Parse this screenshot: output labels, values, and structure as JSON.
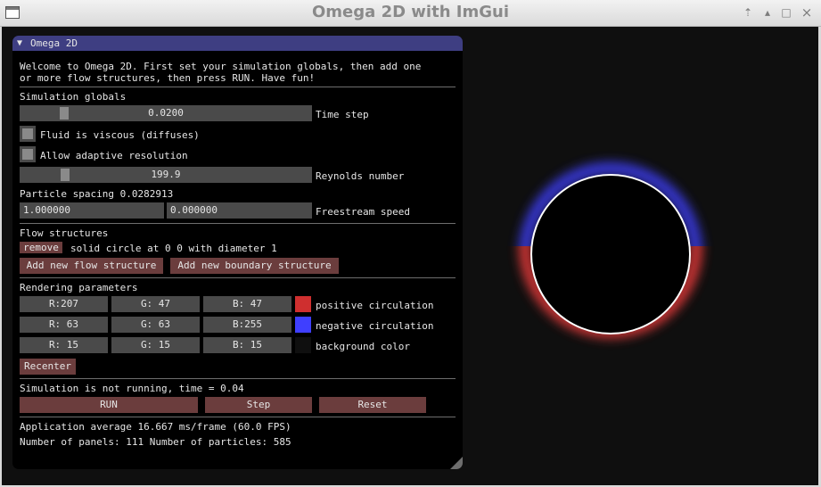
{
  "window": {
    "title": "Omega 2D with ImGui",
    "controls": {
      "pin": "⇡",
      "shade": "▴",
      "maximize": "□",
      "close": "×"
    }
  },
  "panel": {
    "title": "Omega 2D",
    "collapse_arrow": "▼",
    "welcome_line1": "Welcome to Omega 2D. First set your simulation globals, then add one",
    "welcome_line2": "or more flow structures, then press RUN. Have fun!"
  },
  "globals": {
    "heading": "Simulation globals",
    "time_step_value": "0.0200",
    "time_step_label": "Time step",
    "viscous_label": "Fluid is viscous (diffuses)",
    "adaptive_label": "Allow adaptive resolution",
    "reynolds_value": "199.9",
    "reynolds_label": "Reynolds number",
    "particle_spacing": "Particle spacing 0.0282913",
    "freestream_x": "1.000000",
    "freestream_y": "0.000000",
    "freestream_label": "Freestream speed"
  },
  "flow": {
    "heading": "Flow structures",
    "remove_label": "remove",
    "item_text": "solid circle at 0 0 with diameter 1",
    "add_flow_label": "Add new flow structure",
    "add_boundary_label": "Add new boundary structure"
  },
  "rendering": {
    "heading": "Rendering parameters",
    "positive": {
      "r": "R:207",
      "g": "G: 47",
      "b": "B: 47",
      "label": "positive circulation",
      "color": "#cf2f2f"
    },
    "negative": {
      "r": "R: 63",
      "g": "G: 63",
      "b": "B:255",
      "label": "negative circulation",
      "color": "#3f3fff"
    },
    "background": {
      "r": "R: 15",
      "g": "G: 15",
      "b": "B: 15",
      "label": "background color",
      "color": "#0f0f0f"
    },
    "recenter_label": "Recenter"
  },
  "run": {
    "status": "Simulation is not running, time = 0.04",
    "run_label": "RUN",
    "step_label": "Step",
    "reset_label": "Reset"
  },
  "stats": {
    "fps_text": "Application average 16.667 ms/frame (60.0 FPS)",
    "counts_text": "Number of panels: 111  Number of particles: 585"
  },
  "colors": {
    "header": "#3e3e82",
    "button": "#6b3d3d",
    "field": "#4a4a4a"
  }
}
